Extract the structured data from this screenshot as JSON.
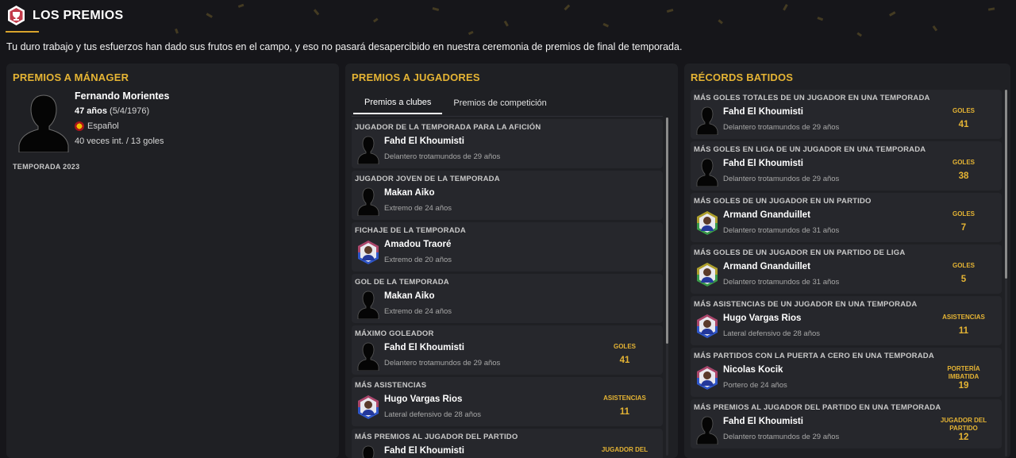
{
  "header": {
    "title": "LOS PREMIOS",
    "subtitle": "Tu duro trabajo y tus esfuerzos han dado sus frutos en el campo, y eso no pasará desapercibido en nuestra ceremonia de premios de final de temporada."
  },
  "colors": {
    "accent": "#e5b434",
    "panel": "#1f2024",
    "card": "#26272c",
    "background": "#16161a"
  },
  "manager": {
    "section_title": "PREMIOS A MÁNAGER",
    "name": "Fernando Morientes",
    "age": "47 años",
    "dob": "(5/4/1976)",
    "nationality": "Español",
    "caps": "40 veces int. / 13 goles",
    "season": "TEMPORADA 2023"
  },
  "players": {
    "section_title": "PREMIOS A JUGADORES",
    "tabs": [
      {
        "label": "Premios a clubes",
        "active": true
      },
      {
        "label": "Premios de competición",
        "active": false
      }
    ],
    "awards": [
      {
        "title": "JUGADOR DE LA TEMPORADA PARA LA AFICIÓN",
        "name": "Fahd El Khoumisti",
        "desc": "Delantero trotamundos de 29 años",
        "avatar": "silhouette",
        "stat_label": "",
        "stat_value": ""
      },
      {
        "title": "JUGADOR JOVEN DE LA TEMPORADA",
        "name": "Makan Aiko",
        "desc": "Extremo de 24 años",
        "avatar": "silhouette",
        "stat_label": "",
        "stat_value": ""
      },
      {
        "title": "FICHAJE DE LA TEMPORADA",
        "name": "Amadou Traoré",
        "desc": "Extremo de 20 años",
        "avatar": "photo-blue",
        "stat_label": "",
        "stat_value": ""
      },
      {
        "title": "GOL DE LA TEMPORADA",
        "name": "Makan Aiko",
        "desc": "Extremo de 24 años",
        "avatar": "silhouette",
        "stat_label": "",
        "stat_value": ""
      },
      {
        "title": "MÁXIMO GOLEADOR",
        "name": "Fahd El Khoumisti",
        "desc": "Delantero trotamundos de 29 años",
        "avatar": "silhouette",
        "stat_label": "GOLES",
        "stat_value": "41"
      },
      {
        "title": "MÁS ASISTENCIAS",
        "name": "Hugo Vargas Rios",
        "desc": "Lateral defensivo de 28 años",
        "avatar": "photo-blue",
        "stat_label": "ASISTENCIAS",
        "stat_value": "11"
      },
      {
        "title": "MÁS PREMIOS AL JUGADOR DEL PARTIDO",
        "name": "Fahd El Khoumisti",
        "desc": "",
        "avatar": "silhouette",
        "stat_label": "JUGADOR DEL",
        "stat_value": ""
      }
    ]
  },
  "records": {
    "section_title": "RÉCORDS BATIDOS",
    "items": [
      {
        "title": "MÁS GOLES TOTALES DE UN JUGADOR EN UNA TEMPORADA",
        "name": "Fahd El Khoumisti",
        "desc": "Delantero trotamundos de 29 años",
        "avatar": "silhouette",
        "stat_label": "GOLES",
        "stat_value": "41"
      },
      {
        "title": "MÁS GOLES EN LIGA DE UN JUGADOR EN UNA TEMPORADA",
        "name": "Fahd El Khoumisti",
        "desc": "Delantero trotamundos de 29 años",
        "avatar": "silhouette",
        "stat_label": "GOLES",
        "stat_value": "38"
      },
      {
        "title": "MÁS GOLES DE UN JUGADOR EN UN PARTIDO",
        "name": "Armand Gnanduillet",
        "desc": "Delantero trotamundos de 31 años",
        "avatar": "photo-green",
        "stat_label": "GOLES",
        "stat_value": "7"
      },
      {
        "title": "MÁS GOLES DE UN JUGADOR EN UN PARTIDO DE LIGA",
        "name": "Armand Gnanduillet",
        "desc": "Delantero trotamundos de 31 años",
        "avatar": "photo-green",
        "stat_label": "GOLES",
        "stat_value": "5"
      },
      {
        "title": "MÁS ASISTENCIAS DE UN JUGADOR EN UNA TEMPORADA",
        "name": "Hugo Vargas Rios",
        "desc": "Lateral defensivo de 28 años",
        "avatar": "photo-blue",
        "stat_label": "ASISTENCIAS",
        "stat_value": "11"
      },
      {
        "title": "MÁS PARTIDOS CON LA PUERTA A CERO EN UNA TEMPORADA",
        "name": "Nicolas Kocik",
        "desc": "Portero de 24 años",
        "avatar": "photo-blue",
        "stat_label": "PORTERÍA IMBATIDA",
        "stat_value": "19"
      },
      {
        "title": "MÁS PREMIOS AL JUGADOR DEL PARTIDO EN UNA TEMPORADA",
        "name": "Fahd El Khoumisti",
        "desc": "Delantero trotamundos de 29 años",
        "avatar": "silhouette",
        "stat_label": "JUGADOR DEL PARTIDO",
        "stat_value": "12"
      }
    ]
  }
}
